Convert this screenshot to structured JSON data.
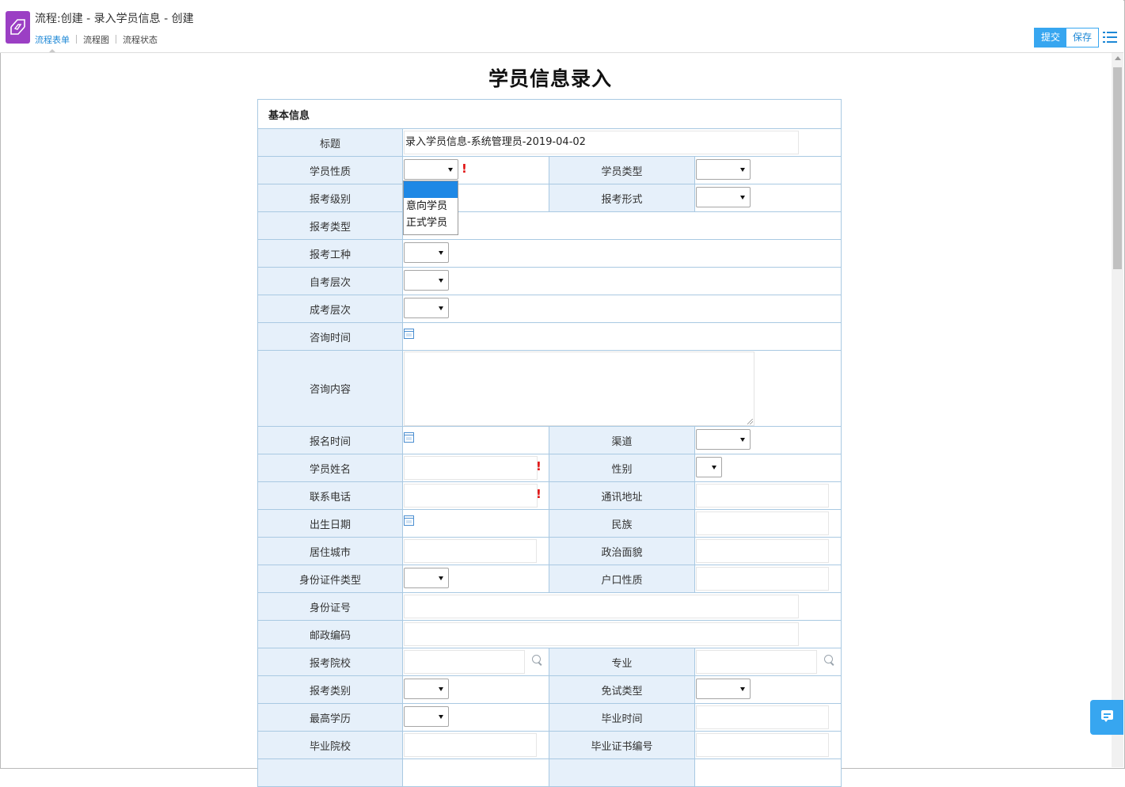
{
  "window": {
    "title": "流程:创建 - 录入学员信息 - 创建"
  },
  "tabs": [
    "流程表单",
    "流程图",
    "流程状态"
  ],
  "toolbar": {
    "submit_label": "提交",
    "save_label": "保存"
  },
  "form": {
    "title": "学员信息录入",
    "section": "基本信息",
    "labels": {
      "title": "标题",
      "student_nature": "学员性质",
      "student_type": "学员类型",
      "exam_level": "报考级别",
      "exam_form": "报考形式",
      "exam_type": "报考类型",
      "exam_trade": "报考工种",
      "self_exam_level": "自考层次",
      "adult_exam_level": "成考层次",
      "consult_time": "咨询时间",
      "consult_content": "咨询内容",
      "signup_time": "报名时间",
      "channel": "渠道",
      "student_name": "学员姓名",
      "gender": "性别",
      "phone": "联系电话",
      "address": "通讯地址",
      "birth_date": "出生日期",
      "ethnicity": "民族",
      "city": "居住城市",
      "political_status": "政治面貌",
      "id_type": "身份证件类型",
      "household_type": "户口性质",
      "id_number": "身份证号",
      "postal_code": "邮政编码",
      "exam_school": "报考院校",
      "major": "专业",
      "exam_category": "报考类别",
      "exemption_type": "免试类型",
      "highest_education": "最高学历",
      "graduation_time": "毕业时间",
      "graduate_school": "毕业院校",
      "certificate_no": "毕业证书编号"
    },
    "values": {
      "title": "录入学员信息-系统管理员-2019-04-02"
    },
    "required_mark": "!",
    "student_nature_options": [
      "",
      "意向学员",
      "正式学员"
    ]
  },
  "colors": {
    "accent": "#37a6f0",
    "label_bg": "#e6f0fa",
    "border": "#a9c9e2",
    "required": "#e01010",
    "app_icon": "#9b3fc4"
  },
  "icons": [
    "app-logo-icon",
    "menu-list-icon",
    "calendar-icon",
    "search-icon",
    "chat-icon",
    "dropdown-arrow-icon"
  ]
}
